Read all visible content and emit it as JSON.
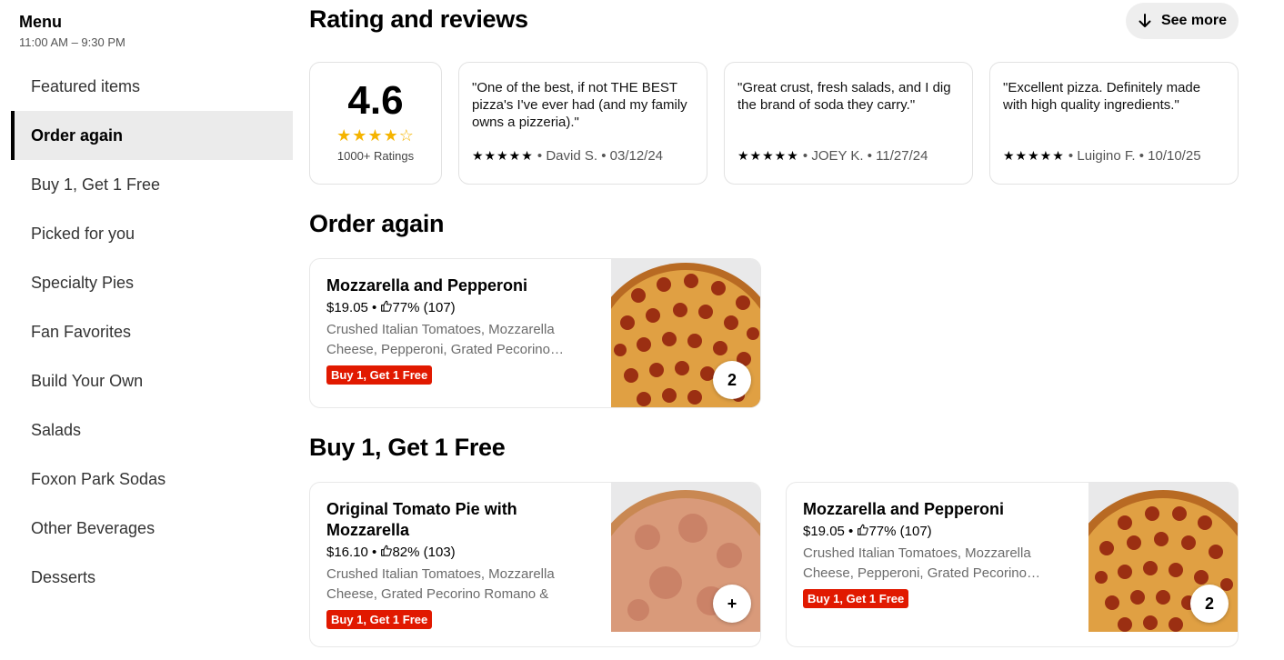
{
  "sidebar": {
    "title": "Menu",
    "hours": "11:00 AM – 9:30 PM",
    "items": [
      {
        "label": "Featured items"
      },
      {
        "label": "Order again"
      },
      {
        "label": "Buy 1, Get 1 Free"
      },
      {
        "label": "Picked for you"
      },
      {
        "label": "Specialty Pies"
      },
      {
        "label": "Fan Favorites"
      },
      {
        "label": "Build Your Own"
      },
      {
        "label": "Salads"
      },
      {
        "label": "Foxon Park Sodas"
      },
      {
        "label": "Other Beverages"
      },
      {
        "label": "Desserts"
      }
    ],
    "active_index": 1
  },
  "ratings": {
    "title": "Rating and reviews",
    "see_more": "See more",
    "score": "4.6",
    "stars": "★★★★☆",
    "count": "1000+ Ratings",
    "reviews": [
      {
        "text": "\"One of the best, if not THE BEST pizza's I've ever had (and my family owns a pizzeria).\"",
        "stars": "★★★★★",
        "meta": " • David S. • 03/12/24"
      },
      {
        "text": "\"Great crust, fresh salads, and I dig the brand of soda they carry.\"",
        "stars": "★★★★★",
        "meta": " • JOEY K. • 11/27/24"
      },
      {
        "text": "\"Excellent pizza. Definitely made with high quality ingredients.\"",
        "stars": "★★★★★",
        "meta": " • Luigino F. • 10/10/25"
      }
    ]
  },
  "order_again": {
    "title": "Order again",
    "items": [
      {
        "name": "Mozzarella and Pepperoni",
        "price": "$19.05 • ",
        "rating": "77% (107)",
        "desc": "Crushed Italian Tomatoes, Mozzarella Cheese, Pepperoni, Grated Pecorino…",
        "badge": "Buy 1, Get 1 Free",
        "qty": "2"
      }
    ]
  },
  "bogo": {
    "title": "Buy 1, Get 1 Free",
    "items": [
      {
        "name": "Original Tomato Pie with Mozzarella",
        "price": "$16.10 • ",
        "rating": "82% (103)",
        "desc": "Crushed Italian Tomatoes, Mozzarella Cheese, Grated Pecorino Romano & Oli…",
        "badge": "Buy 1, Get 1 Free",
        "qty": "+"
      },
      {
        "name": "Mozzarella and Pepperoni",
        "price": "$19.05 • ",
        "rating": "77% (107)",
        "desc": "Crushed Italian Tomatoes, Mozzarella Cheese, Pepperoni, Grated Pecorino…",
        "badge": "Buy 1, Get 1 Free",
        "qty": "2"
      }
    ]
  },
  "colors": {
    "accent_badge": "#e11900",
    "star": "#f5b400",
    "active_nav_bg": "#ebebeb"
  },
  "icons": {
    "see_more": "arrow-down-icon",
    "rating": "thumbs-up-icon",
    "pizza_pepperoni": "pepperoni-pizza-image",
    "pizza_tomato": "tomato-pie-image"
  }
}
